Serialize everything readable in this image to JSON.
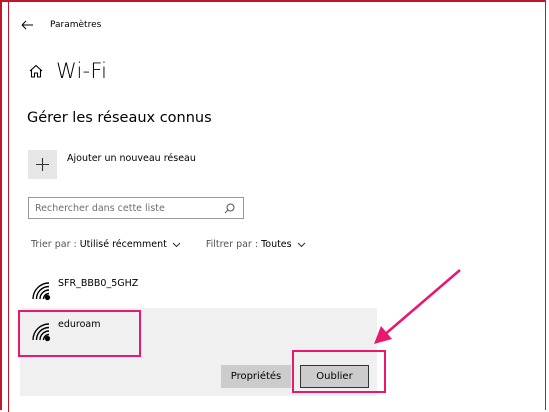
{
  "window": {
    "title": "Paramètres"
  },
  "page": {
    "title": "Wi-Fi"
  },
  "section": {
    "title": "Gérer les réseaux connus"
  },
  "add_network": {
    "label": "Ajouter un nouveau réseau"
  },
  "search": {
    "placeholder": "Rechercher dans cette liste"
  },
  "filters": {
    "sort_label": "Trier par :",
    "sort_value": "Utilisé récemment",
    "filter_label": "Filtrer par :",
    "filter_value": "Toutes"
  },
  "networks": [
    {
      "name": "SFR_BBB0_5GHZ",
      "icon": "wifi-secured-icon",
      "selected": false
    },
    {
      "name": "eduroam",
      "icon": "wifi-secured-icon",
      "selected": true
    }
  ],
  "actions": {
    "properties_label": "Propriétés",
    "forget_label": "Oublier"
  },
  "colors": {
    "annotation": "#e8186f",
    "frame": "#c0162b",
    "selected_row": "#f0f0f0",
    "button": "#cccccc"
  }
}
